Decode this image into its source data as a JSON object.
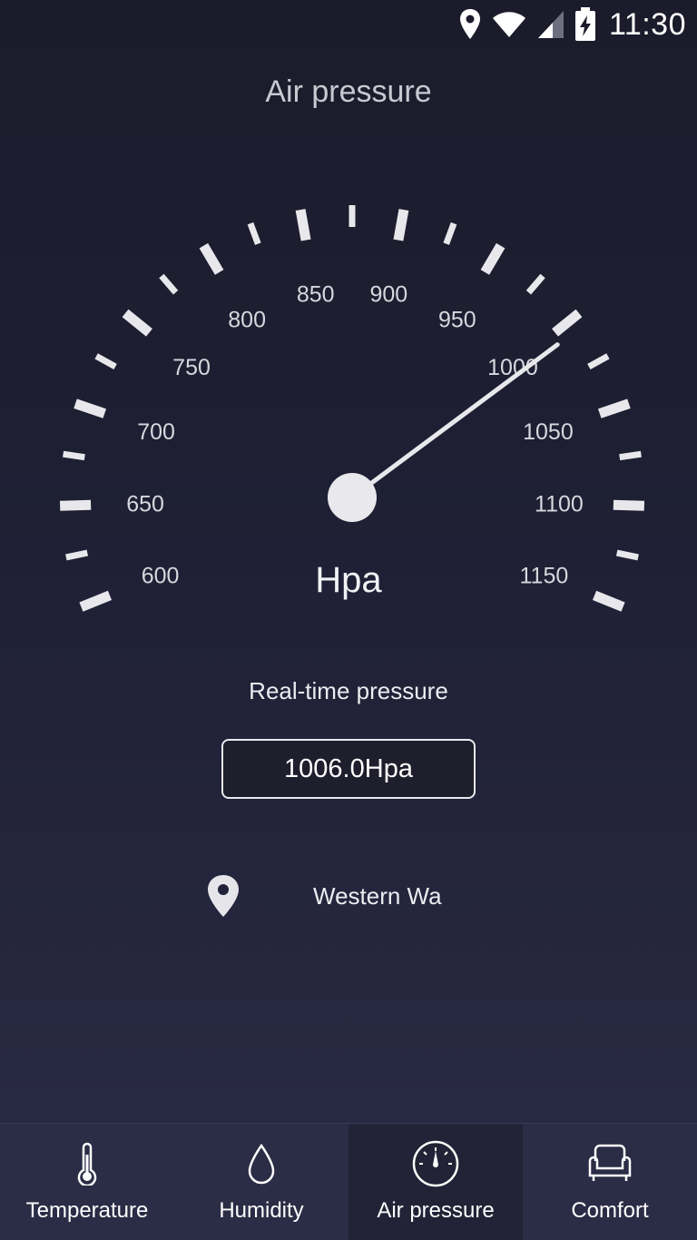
{
  "status_bar": {
    "time": "11:30",
    "icons": [
      "location-pin-icon",
      "wifi-icon",
      "signal-icon",
      "battery-charging-icon"
    ]
  },
  "header": {
    "title": "Air pressure"
  },
  "gauge": {
    "unit": "Hpa",
    "min": 600,
    "max": 1150,
    "tick_labels": [
      "600",
      "650",
      "700",
      "750",
      "800",
      "850",
      "900",
      "950",
      "1000",
      "1050",
      "1100",
      "1150"
    ],
    "needle_value": 1006.0,
    "colors": {
      "ticks": "#e8e8ec",
      "needle": "#e8e8ec",
      "hub": "#e9e9ed"
    }
  },
  "reading": {
    "label": "Real-time pressure",
    "value": "1006.0Hpa"
  },
  "location": {
    "icon": "location-pin-icon",
    "name": "Western Wa"
  },
  "bottom_nav": {
    "items": [
      {
        "label": "Temperature",
        "icon": "thermometer-icon",
        "active": false
      },
      {
        "label": "Humidity",
        "icon": "droplet-icon",
        "active": false
      },
      {
        "label": "Air pressure",
        "icon": "gauge-icon",
        "active": true
      },
      {
        "label": "Comfort",
        "icon": "armchair-icon",
        "active": false
      }
    ]
  }
}
